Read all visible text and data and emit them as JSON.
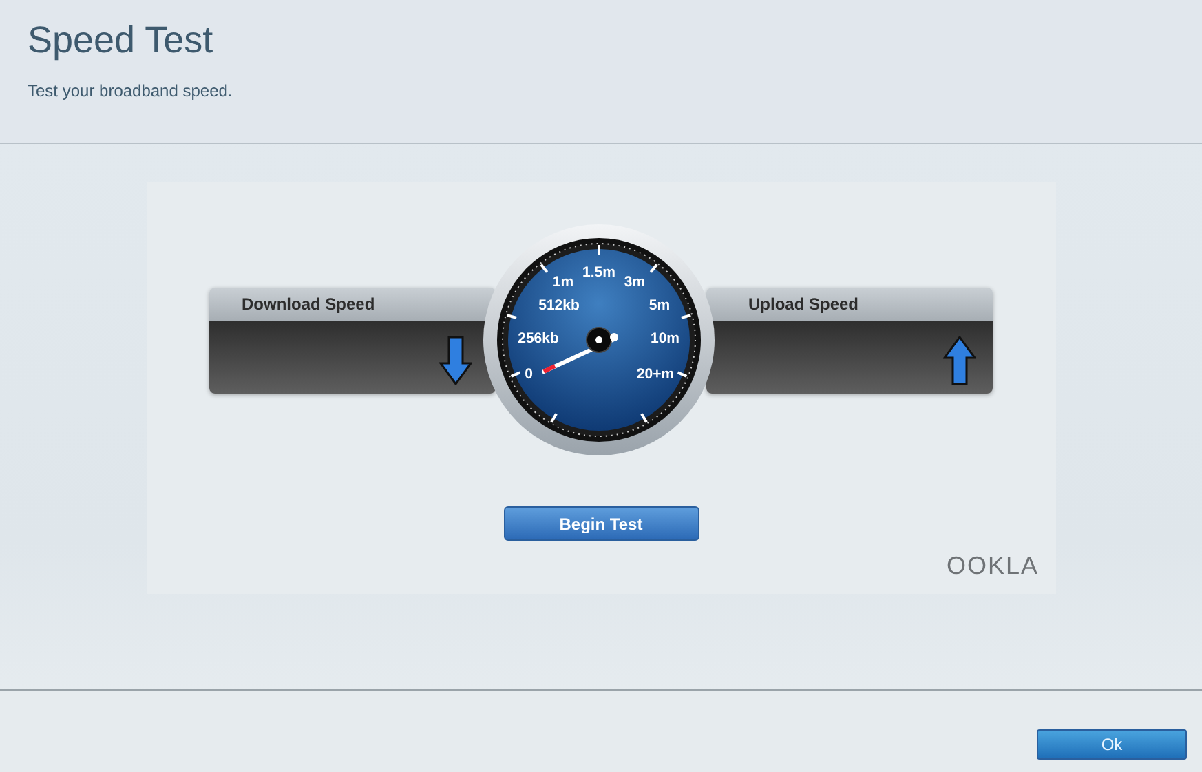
{
  "header": {
    "title": "Speed Test",
    "subtitle": "Test your broadband speed."
  },
  "speed_test": {
    "download_label": "Download Speed",
    "upload_label": "Upload Speed",
    "gauge_labels": [
      "0",
      "256kb",
      "512kb",
      "1m",
      "1.5m",
      "3m",
      "5m",
      "10m",
      "20+m"
    ],
    "button": "Begin Test",
    "logo": "OOKLA"
  },
  "footer": {
    "button": "Ok"
  }
}
